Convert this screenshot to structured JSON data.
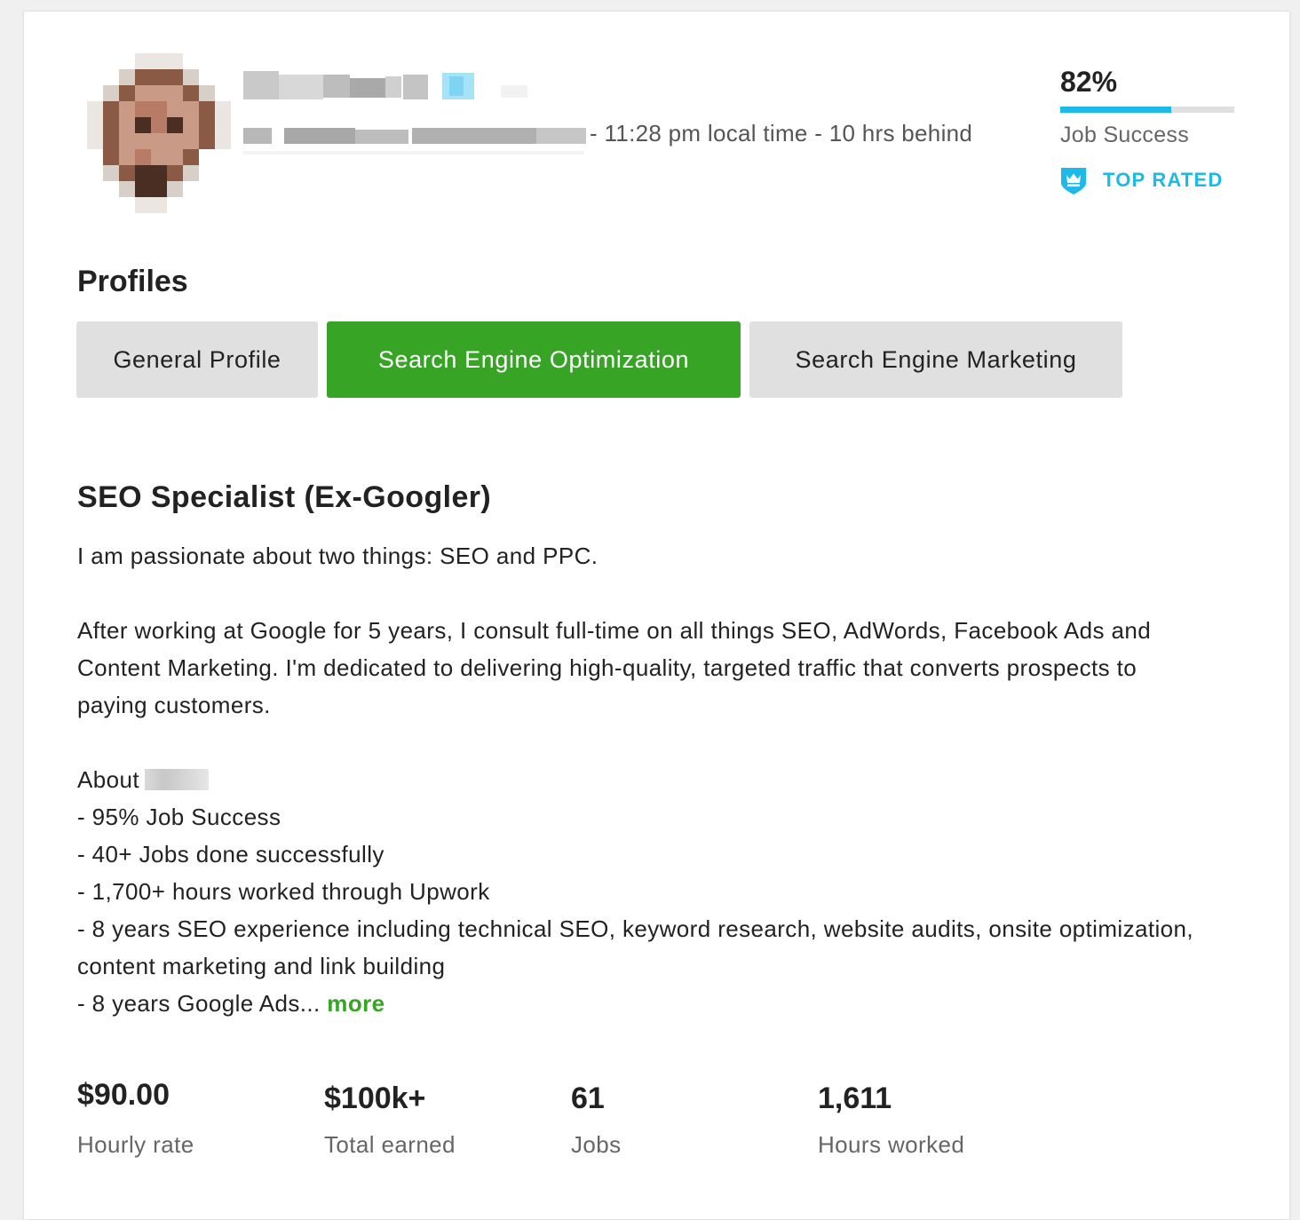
{
  "header": {
    "local_time": "- 11:28 pm local time - 10 hrs behind"
  },
  "job_success": {
    "percent_label": "82%",
    "fill_fraction": 0.64,
    "label": "Job Success",
    "bar_color": "#1db9e8"
  },
  "badge": {
    "label": "TOP RATED",
    "icon": "crown-shield-icon",
    "color": "#1db9e8"
  },
  "profiles": {
    "heading": "Profiles",
    "tabs": [
      {
        "label": "General Profile",
        "active": false
      },
      {
        "label": "Search Engine Optimization",
        "active": true
      },
      {
        "label": "Search Engine Marketing",
        "active": false
      }
    ],
    "active_color": "#37a426"
  },
  "profile": {
    "title": "SEO Specialist (Ex-Googler)",
    "intro": "I am passionate about two things: SEO and PPC.",
    "para1": "After working at Google for 5 years, I consult full-time on all things SEO, AdWords, Facebook Ads and Content Marketing. I'm dedicated to delivering high-quality, targeted traffic that converts prospects to paying customers.",
    "about_label": "About",
    "bullets": [
      "- 95% Job Success",
      "- 40+ Jobs done successfully",
      "- 1,700+ hours worked through Upwork",
      "- 8 years SEO experience including technical SEO, keyword research, website audits, onsite optimization, content marketing and link building"
    ],
    "last_bullet": "- 8 years Google Ads...",
    "more_label": "more"
  },
  "stats": [
    {
      "value": "$90.00",
      "label": "Hourly rate"
    },
    {
      "value": "$100k+",
      "label": "Total earned"
    },
    {
      "value": "61",
      "label": "Jobs"
    },
    {
      "value": "1,611",
      "label": "Hours worked"
    }
  ]
}
